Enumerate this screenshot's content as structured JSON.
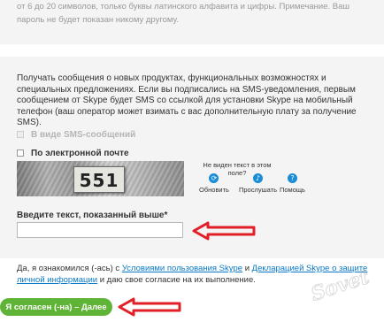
{
  "password_hint": "от 6 до 20 символов, только буквы латинского алфавита и цифры. Примечание. Ваш пароль не будет показан никому другому.",
  "newsletter_info": "Получать сообщения о новых продуктах, функциональных возможностях и специальных предложениях. Если вы подписались на SMS-уведомления, первым сообщением от Skype будет SMS со ссылкой для установки Skype на мобильный телефон (ваш оператор может взимать с вас дополнительную плату за получение SMS).",
  "options": {
    "sms_label": "В виде SMS-сообщений",
    "email_label": "По электронной почте"
  },
  "captcha": {
    "image_text": "551",
    "question": "Не виден текст в этом поле?",
    "refresh_label": "Обновить",
    "listen_label": "Прослушать",
    "help_label": "Помощь"
  },
  "captcha_input": {
    "label": "Введите текст, показанный выше*",
    "value": ""
  },
  "terms": {
    "prefix": "Да, я ознакомился (-ась) с ",
    "terms_link": "Условиями пользования Skype",
    "middle": " и ",
    "privacy_link": "Декларацией Skype о защите личной информации",
    "suffix": " и даю свое согласие на их выполнение."
  },
  "agree_button": "Я согласен (-на) – Далее",
  "watermark": "Sovet",
  "colors": {
    "panel_bg": "#f4f4f4",
    "link": "#0a7ac8",
    "button_green": "#5fb336",
    "arrow_red": "#e21f26",
    "icon_blue": "#1a8cd8"
  }
}
